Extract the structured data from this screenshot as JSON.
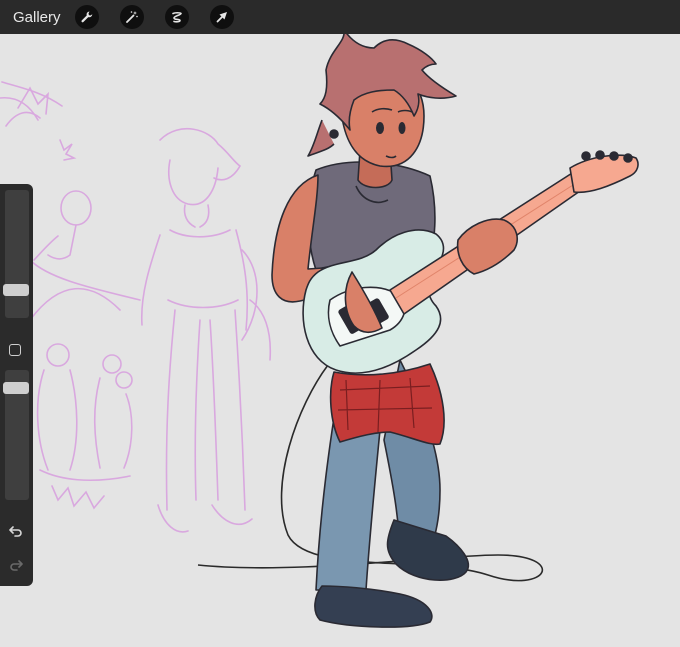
{
  "topbar": {
    "gallery_label": "Gallery",
    "tools": [
      "wrench-icon",
      "magic-wand-icon",
      "selection-icon",
      "transform-arrow-icon"
    ]
  },
  "sidebar": {
    "brush_size_fraction": 0.73,
    "opacity_fraction": 0.95,
    "controls": [
      "brush-size-slider",
      "modify-button",
      "opacity-slider",
      "undo-icon",
      "redo-icon"
    ]
  },
  "colors": {
    "topbar": "#2a2a2a",
    "canvas": "#e4e4e4",
    "sketch": "#d9a8df",
    "skin": "#d98068",
    "hair": "#b87070",
    "shirt": "#6f6a7a",
    "jeans": "#6f8ca6",
    "boots": "#2f3a4a",
    "guitar_body": "#d8ece6",
    "neck": "#f6a890",
    "flannel": "#c33a38"
  }
}
